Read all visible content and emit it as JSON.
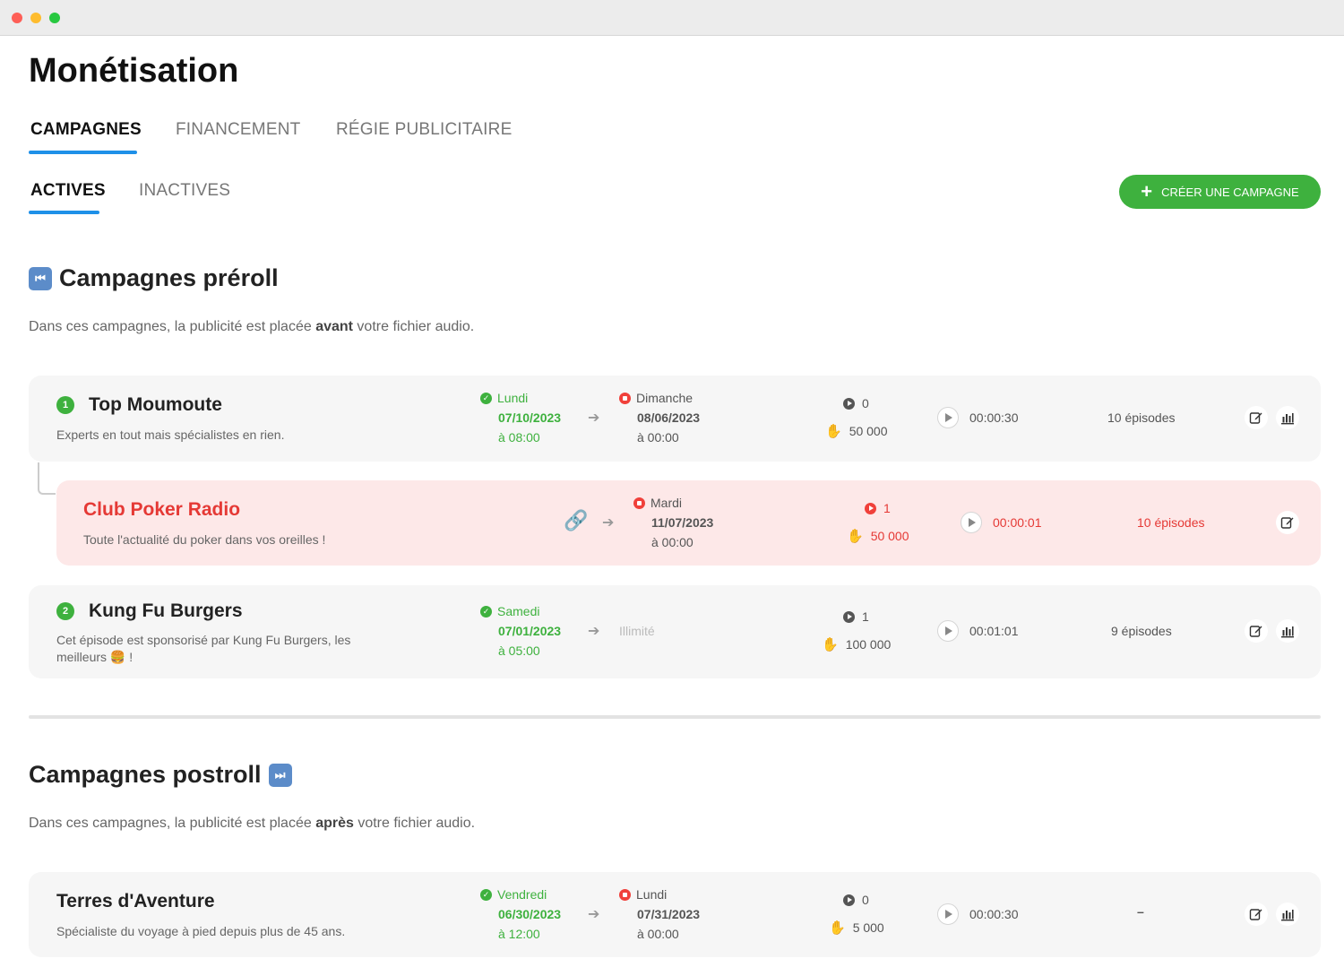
{
  "page": {
    "title": "Monétisation"
  },
  "tabs": [
    {
      "label": "CAMPAGNES",
      "active": true
    },
    {
      "label": "FINANCEMENT",
      "active": false
    },
    {
      "label": "RÉGIE PUBLICITAIRE",
      "active": false
    }
  ],
  "subtabs": [
    {
      "label": "ACTIVES",
      "active": true
    },
    {
      "label": "INACTIVES",
      "active": false
    }
  ],
  "create_button": {
    "label": "CRÉER UNE CAMPAGNE"
  },
  "colors": {
    "accent": "#1e90e8",
    "success": "#3eb13e",
    "danger": "#e53935"
  },
  "sections": [
    {
      "title": "Campagnes préroll",
      "icon": "rewind-icon",
      "desc_before": "Dans ces campagnes, la publicité est placée ",
      "desc_bold": "avant",
      "desc_after": " votre fichier audio.",
      "campaigns": [
        {
          "badge": "1",
          "name": "Top Moumoute",
          "description": "Experts en tout mais spécialistes en rien.",
          "start": {
            "day": "Lundi",
            "date": "07/10/2023",
            "time": "à 08:00"
          },
          "end": {
            "day": "Dimanche",
            "date": "08/06/2023",
            "time": "à 00:00"
          },
          "listens": "0",
          "limit": "50 000",
          "duration": "00:00:30",
          "episodes": "10 épisodes"
        },
        {
          "badge": "",
          "name": "Club Poker Radio",
          "description": "Toute l'actualité du poker dans vos oreilles !",
          "start": null,
          "end": {
            "day": "Mardi",
            "date": "11/07/2023",
            "time": "à 00:00"
          },
          "listens": "1",
          "limit": "50 000",
          "duration": "00:00:01",
          "episodes": "10 épisodes"
        },
        {
          "badge": "2",
          "name": "Kung Fu Burgers",
          "description": "Cet épisode est sponsorisé par Kung Fu Burgers, les meilleurs 🍔 !",
          "start": {
            "day": "Samedi",
            "date": "07/01/2023",
            "time": "à 05:00"
          },
          "end_label": "Illimité",
          "listens": "1",
          "limit": "100 000",
          "duration": "00:01:01",
          "episodes": "9 épisodes"
        }
      ]
    },
    {
      "title": "Campagnes postroll",
      "icon": "fast-forward-icon",
      "desc_before": "Dans ces campagnes, la publicité est placée ",
      "desc_bold": "après",
      "desc_after": " votre fichier audio.",
      "campaigns": [
        {
          "name": "Terres d'Aventure",
          "description": "Spécialiste du voyage à pied depuis plus de 45 ans.",
          "start": {
            "day": "Vendredi",
            "date": "06/30/2023",
            "time": "à 12:00"
          },
          "end": {
            "day": "Lundi",
            "date": "07/31/2023",
            "time": "à 00:00"
          },
          "listens": "0",
          "limit": "5 000",
          "duration": "00:00:30",
          "episodes": "–"
        }
      ]
    }
  ]
}
